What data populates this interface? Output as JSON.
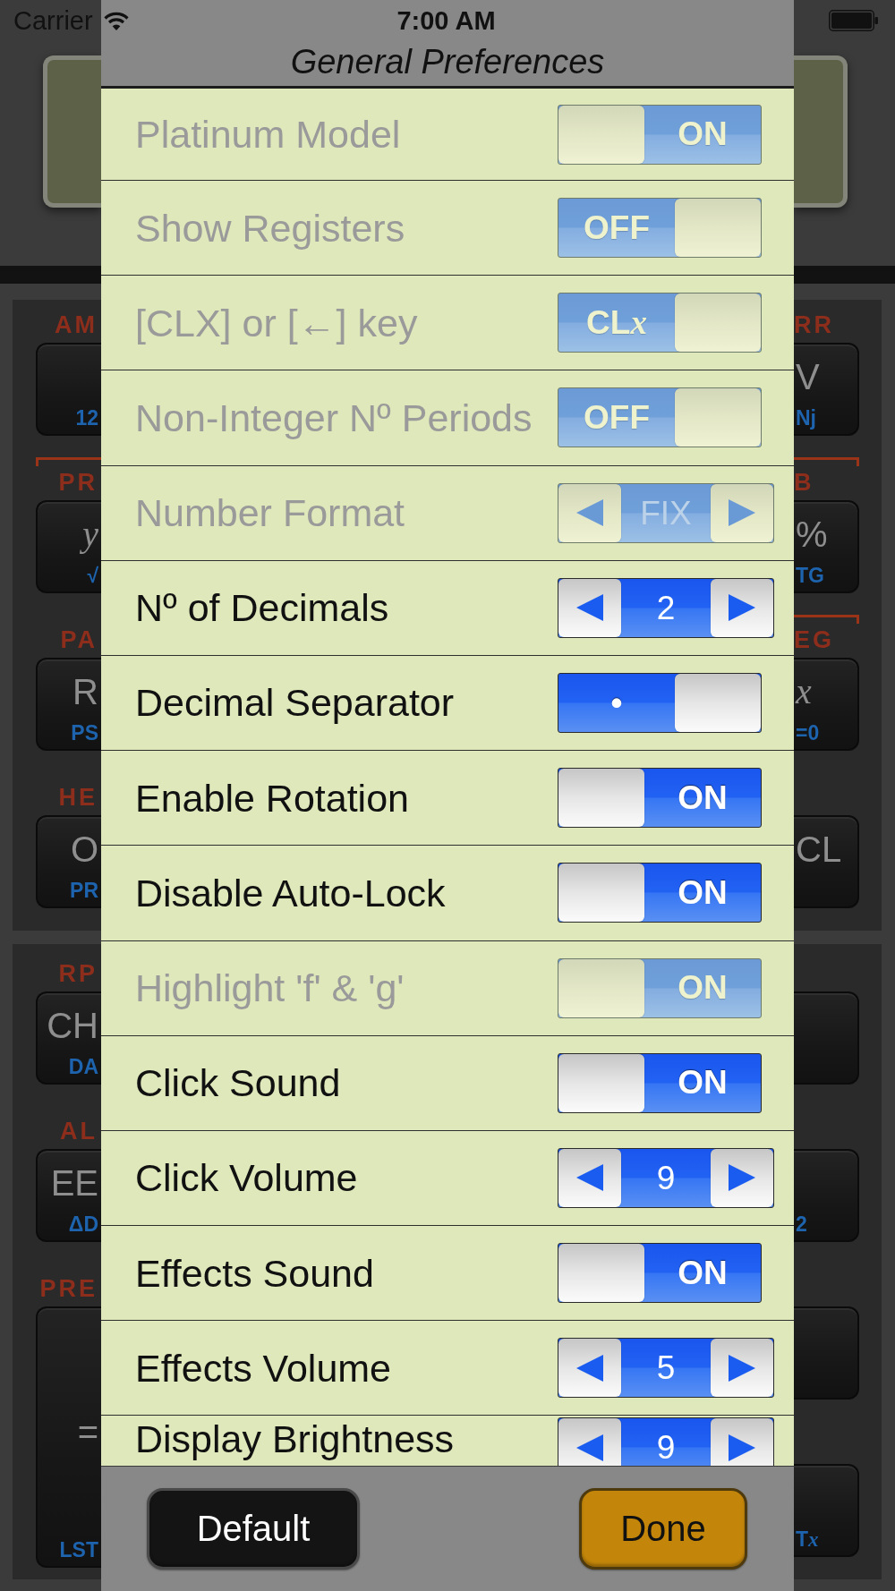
{
  "status_bar": {
    "carrier": "Carrier",
    "time": "7:00 AM"
  },
  "title": "General Preferences",
  "settings": [
    {
      "label": "Platinum Model",
      "kind": "toggle",
      "disabled": true,
      "on": true,
      "text": "ON"
    },
    {
      "label": "Show Registers",
      "kind": "toggle",
      "disabled": true,
      "on": false,
      "text": "OFF"
    },
    {
      "label": "[CLX] or [←] key",
      "kind": "toggle",
      "disabled": true,
      "on": false,
      "text": "CL",
      "variable": "x"
    },
    {
      "label": "Non-Integer Nº Periods",
      "kind": "toggle",
      "disabled": true,
      "on": false,
      "text": "OFF"
    },
    {
      "label": "Number Format",
      "kind": "stepper",
      "disabled": true,
      "value": "FIX"
    },
    {
      "label": "Nº of Decimals",
      "kind": "stepper",
      "disabled": false,
      "value": "2"
    },
    {
      "label": "Decimal Separator",
      "kind": "toggle",
      "disabled": false,
      "on": false,
      "text": "•"
    },
    {
      "label": "Enable Rotation",
      "kind": "toggle",
      "disabled": false,
      "on": true,
      "text": "ON"
    },
    {
      "label": "Disable Auto-Lock",
      "kind": "toggle",
      "disabled": false,
      "on": true,
      "text": "ON"
    },
    {
      "label": "Highlight 'f' & 'g'",
      "kind": "toggle",
      "disabled": true,
      "on": true,
      "text": "ON"
    },
    {
      "label": "Click Sound",
      "kind": "toggle",
      "disabled": false,
      "on": true,
      "text": "ON"
    },
    {
      "label": "Click Volume",
      "kind": "stepper",
      "disabled": false,
      "value": "9"
    },
    {
      "label": "Effects Sound",
      "kind": "toggle",
      "disabled": false,
      "on": true,
      "text": "ON"
    },
    {
      "label": "Effects Volume",
      "kind": "stepper",
      "disabled": false,
      "value": "5"
    },
    {
      "label": "Display Brightness",
      "kind": "stepper",
      "disabled": false,
      "value": "9"
    }
  ],
  "buttons": [
    {
      "label": "Default",
      "kind": "secondary"
    },
    {
      "label": "Done",
      "kind": "primary"
    }
  ],
  "calculator": {
    "keypads": [
      {
        "left_keys": [
          {
            "label": "AM",
            "sub": "12",
            "kind": "plain",
            "tall": false
          },
          {
            "label": "PR",
            "glyph": {
              "text": "y",
              "italic": true
            },
            "sub": "√",
            "kind": "bracketed",
            "tall": false
          },
          {
            "label": "PA",
            "glyph": {
              "text": "R",
              "italic": false
            },
            "sub": "PS",
            "kind": "plain",
            "tall": false
          },
          {
            "label": "HE",
            "glyph": {
              "text": "O",
              "italic": false
            },
            "sub": "PR",
            "kind": "plain",
            "tall": false
          }
        ],
        "right_keys": [
          {
            "label": "RR",
            "glyph": {
              "text": "V",
              "italic": false
            },
            "sub": "Nj",
            "kind": "plain",
            "tall": false
          },
          {
            "label": "B",
            "glyph": {
              "text": "%",
              "italic": false
            },
            "sub": "TG",
            "kind": "bracketed",
            "tall": false
          },
          {
            "label": "EG",
            "glyph": {
              "text": "x",
              "italic": true
            },
            "sub": "=0",
            "kind": "bracketed",
            "tall": false
          },
          {
            "glyph": {
              "text": "CL",
              "italic": false
            },
            "kind": "plain",
            "tall": false
          }
        ]
      },
      {
        "left_keys": [
          {
            "label": "RP",
            "glyph": {
              "text": "CH",
              "italic": false
            },
            "sub": "DA",
            "kind": "plain",
            "tall": false
          },
          {
            "label": "AL",
            "glyph": {
              "text": "EE",
              "italic": false
            },
            "sub": "ΔD",
            "kind": "plain",
            "tall": false
          },
          {
            "label": "PRE",
            "glyph": {
              "text": "=",
              "italic": false
            },
            "sub": "LST",
            "kind": "plain",
            "tall": true
          }
        ],
        "right_keys": [
          {
            "kind": "plain",
            "tall": false
          },
          {
            "sub": "2",
            "kind": "plain",
            "tall": false
          },
          {
            "kind": "plain",
            "tall": false
          },
          {
            "sub": "T",
            "sub_variable": "x",
            "kind": "plain",
            "tall": false
          }
        ]
      }
    ]
  }
}
